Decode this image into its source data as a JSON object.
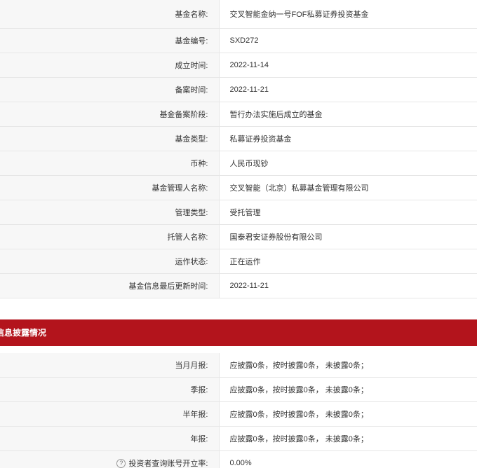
{
  "basic_info": {
    "rows": [
      {
        "label": "基金名称:",
        "value": "交叉智能金纳一号FOF私募证券投资基金"
      },
      {
        "label": "基金编号:",
        "value": "SXD272"
      },
      {
        "label": "成立时间:",
        "value": "2022-11-14"
      },
      {
        "label": "备案时间:",
        "value": "2022-11-21"
      },
      {
        "label": "基金备案阶段:",
        "value": "暂行办法实施后成立的基金"
      },
      {
        "label": "基金类型:",
        "value": "私募证券投资基金"
      },
      {
        "label": "币种:",
        "value": "人民币现钞"
      },
      {
        "label": "基金管理人名称:",
        "value": "交叉智能（北京）私募基金管理有限公司"
      },
      {
        "label": "管理类型:",
        "value": "受托管理"
      },
      {
        "label": "托管人名称:",
        "value": "国泰君安证券股份有限公司"
      },
      {
        "label": "运作状态:",
        "value": "正在运作"
      },
      {
        "label": "基金信息最后更新时间:",
        "value": "2022-11-21"
      }
    ]
  },
  "disclosure": {
    "title": "信息披露情况",
    "rows": [
      {
        "label": "当月月报:",
        "value": "应披露0条，按时披露0条， 未披露0条；"
      },
      {
        "label": "季报:",
        "value": "应披露0条，按时披露0条， 未披露0条；"
      },
      {
        "label": "半年报:",
        "value": "应披露0条，按时披露0条， 未披露0条；"
      },
      {
        "label": "年报:",
        "value": "应披露0条，按时披露0条， 未披露0条；"
      }
    ],
    "investor_rate": {
      "label": "投资者查询账号开立率:",
      "value": "0.00%",
      "help_glyph": "?"
    }
  },
  "colors": {
    "header_red": "#b3141c",
    "label_bg": "#f7f7f7",
    "border": "#e6e6e6"
  }
}
